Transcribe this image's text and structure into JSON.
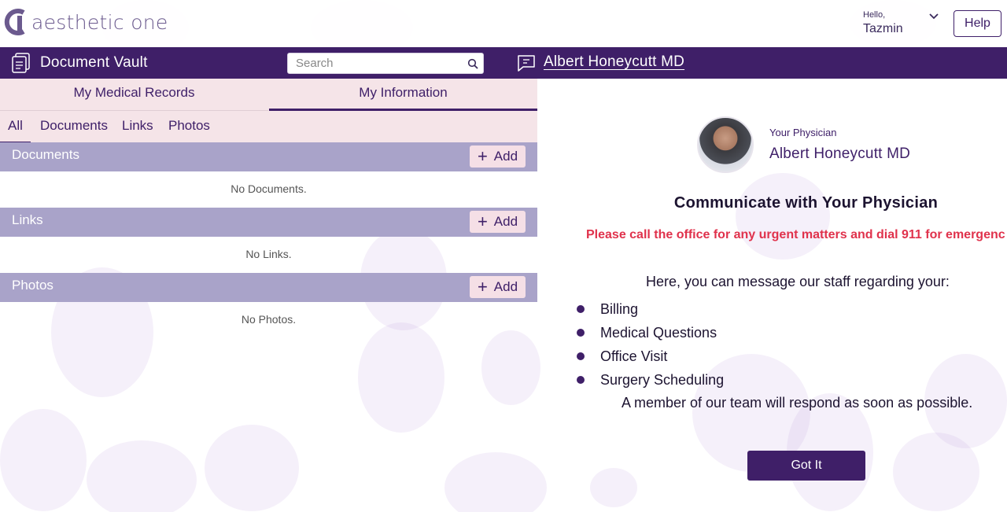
{
  "header": {
    "logo_text": "aesthetic one",
    "greeting": "Hello,",
    "user_name": "Tazmin",
    "help_label": "Help"
  },
  "topbar": {
    "title": "Document Vault",
    "search_placeholder": "Search",
    "physician_link": "Albert Honeycutt MD"
  },
  "left_panel": {
    "tabs": [
      {
        "label": "My Medical Records"
      },
      {
        "label": "My Information",
        "active": true
      }
    ],
    "subtabs": [
      {
        "label": "All",
        "active": true
      },
      {
        "label": "Documents"
      },
      {
        "label": "Links"
      },
      {
        "label": "Photos"
      }
    ],
    "sections": [
      {
        "title": "Documents",
        "add_label": "Add",
        "empty_text": "No Documents."
      },
      {
        "title": "Links",
        "add_label": "Add",
        "empty_text": "No Links."
      },
      {
        "title": "Photos",
        "add_label": "Add",
        "empty_text": "No Photos."
      }
    ]
  },
  "right_panel": {
    "your_physician_label": "Your Physician",
    "physician_name": "Albert Honeycutt MD",
    "title": "Communicate with Your Physician",
    "urgent_notice": "Please call the office for any urgent matters and dial 911 for emergenc",
    "intro": "Here, you can message our staff regarding your:",
    "topics": [
      "Billing",
      "Medical Questions",
      "Office Visit",
      "Surgery Scheduling"
    ],
    "response_note": "A member of our team will respond as soon as possible.",
    "button_label": "Got It"
  },
  "colors": {
    "brand_purple": "#3f1f68",
    "section_header": "#a9a3c9",
    "tab_background": "#f5e4e8",
    "urgent_red": "#e0324c"
  }
}
